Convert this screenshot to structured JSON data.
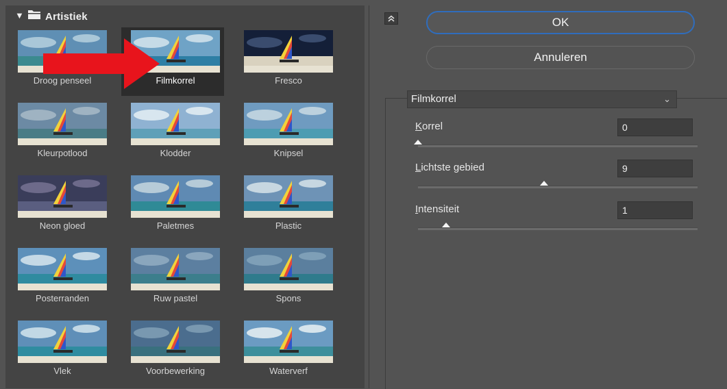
{
  "gallery": {
    "category": "Artistiek",
    "tiles": [
      {
        "label": "Droog penseel"
      },
      {
        "label": "Filmkorrel"
      },
      {
        "label": "Fresco"
      },
      {
        "label": "Kleurpotlood"
      },
      {
        "label": "Klodder"
      },
      {
        "label": "Knipsel"
      },
      {
        "label": "Neon gloed"
      },
      {
        "label": "Paletmes"
      },
      {
        "label": "Plastic"
      },
      {
        "label": "Posterranden"
      },
      {
        "label": "Ruw pastel"
      },
      {
        "label": "Spons"
      },
      {
        "label": "Vlek"
      },
      {
        "label": "Voorbewerking"
      },
      {
        "label": "Waterverf"
      }
    ],
    "selected": "Filmkorrel"
  },
  "buttons": {
    "ok": "OK",
    "cancel": "Annuleren"
  },
  "filter": {
    "selected": "Filmkorrel",
    "params": [
      {
        "accel": "K",
        "rest": "orrel",
        "value": "0",
        "slider": 0.0
      },
      {
        "accel": "L",
        "rest": "ichtste gebied",
        "value": "9",
        "slider": 0.45
      },
      {
        "accel": "I",
        "rest": "ntensiteit",
        "value": "1",
        "slider": 0.1
      }
    ]
  },
  "icons": {
    "collapse": "double-chevron-up-icon",
    "folder": "folder-icon",
    "pointer": "red-arrow-icon"
  },
  "colors": {
    "arrow": "#e8141c",
    "ok_border": "#2f6dbd"
  }
}
